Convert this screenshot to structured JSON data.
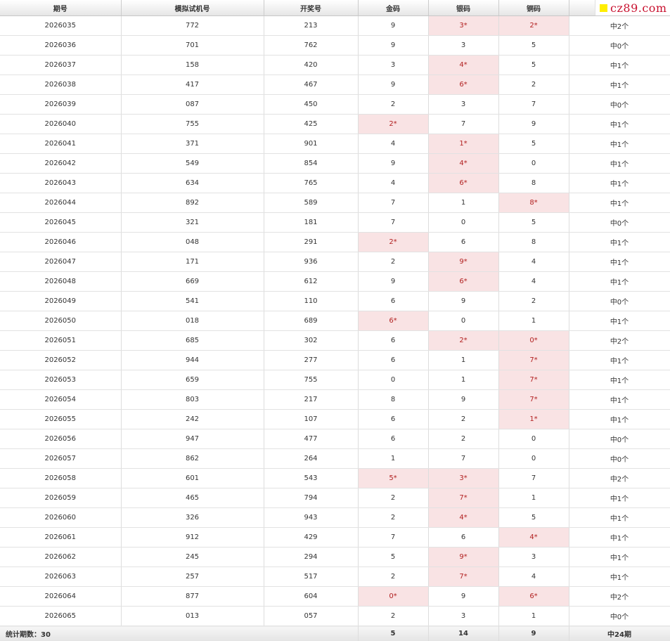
{
  "table": {
    "headers": [
      "期号",
      "模拟试机号",
      "开奖号",
      "金码",
      "银码",
      "铜码",
      ""
    ],
    "rows": [
      {
        "issue": "2026035",
        "sim": "772",
        "draw": "213",
        "gold": "9",
        "gold_hit": false,
        "silver": "3*",
        "silver_hit": true,
        "bronze": "2*",
        "bronze_hit": true,
        "result": "中2个"
      },
      {
        "issue": "2026036",
        "sim": "701",
        "draw": "762",
        "gold": "9",
        "gold_hit": false,
        "silver": "3",
        "silver_hit": false,
        "bronze": "5",
        "bronze_hit": false,
        "result": "中0个"
      },
      {
        "issue": "2026037",
        "sim": "158",
        "draw": "420",
        "gold": "3",
        "gold_hit": false,
        "silver": "4*",
        "silver_hit": true,
        "bronze": "5",
        "bronze_hit": false,
        "result": "中1个"
      },
      {
        "issue": "2026038",
        "sim": "417",
        "draw": "467",
        "gold": "9",
        "gold_hit": false,
        "silver": "6*",
        "silver_hit": true,
        "bronze": "2",
        "bronze_hit": false,
        "result": "中1个"
      },
      {
        "issue": "2026039",
        "sim": "087",
        "draw": "450",
        "gold": "2",
        "gold_hit": false,
        "silver": "3",
        "silver_hit": false,
        "bronze": "7",
        "bronze_hit": false,
        "result": "中0个"
      },
      {
        "issue": "2026040",
        "sim": "755",
        "draw": "425",
        "gold": "2*",
        "gold_hit": true,
        "silver": "7",
        "silver_hit": false,
        "bronze": "9",
        "bronze_hit": false,
        "result": "中1个"
      },
      {
        "issue": "2026041",
        "sim": "371",
        "draw": "901",
        "gold": "4",
        "gold_hit": false,
        "silver": "1*",
        "silver_hit": true,
        "bronze": "5",
        "bronze_hit": false,
        "result": "中1个"
      },
      {
        "issue": "2026042",
        "sim": "549",
        "draw": "854",
        "gold": "9",
        "gold_hit": false,
        "silver": "4*",
        "silver_hit": true,
        "bronze": "0",
        "bronze_hit": false,
        "result": "中1个"
      },
      {
        "issue": "2026043",
        "sim": "634",
        "draw": "765",
        "gold": "4",
        "gold_hit": false,
        "silver": "6*",
        "silver_hit": true,
        "bronze": "8",
        "bronze_hit": false,
        "result": "中1个"
      },
      {
        "issue": "2026044",
        "sim": "892",
        "draw": "589",
        "gold": "7",
        "gold_hit": false,
        "silver": "1",
        "silver_hit": false,
        "bronze": "8*",
        "bronze_hit": true,
        "result": "中1个"
      },
      {
        "issue": "2026045",
        "sim": "321",
        "draw": "181",
        "gold": "7",
        "gold_hit": false,
        "silver": "0",
        "silver_hit": false,
        "bronze": "5",
        "bronze_hit": false,
        "result": "中0个"
      },
      {
        "issue": "2026046",
        "sim": "048",
        "draw": "291",
        "gold": "2*",
        "gold_hit": true,
        "silver": "6",
        "silver_hit": false,
        "bronze": "8",
        "bronze_hit": false,
        "result": "中1个"
      },
      {
        "issue": "2026047",
        "sim": "171",
        "draw": "936",
        "gold": "2",
        "gold_hit": false,
        "silver": "9*",
        "silver_hit": true,
        "bronze": "4",
        "bronze_hit": false,
        "result": "中1个"
      },
      {
        "issue": "2026048",
        "sim": "669",
        "draw": "612",
        "gold": "9",
        "gold_hit": false,
        "silver": "6*",
        "silver_hit": true,
        "bronze": "4",
        "bronze_hit": false,
        "result": "中1个"
      },
      {
        "issue": "2026049",
        "sim": "541",
        "draw": "110",
        "gold": "6",
        "gold_hit": false,
        "silver": "9",
        "silver_hit": false,
        "bronze": "2",
        "bronze_hit": false,
        "result": "中0个"
      },
      {
        "issue": "2026050",
        "sim": "018",
        "draw": "689",
        "gold": "6*",
        "gold_hit": true,
        "silver": "0",
        "silver_hit": false,
        "bronze": "1",
        "bronze_hit": false,
        "result": "中1个"
      },
      {
        "issue": "2026051",
        "sim": "685",
        "draw": "302",
        "gold": "6",
        "gold_hit": false,
        "silver": "2*",
        "silver_hit": true,
        "bronze": "0*",
        "bronze_hit": true,
        "result": "中2个"
      },
      {
        "issue": "2026052",
        "sim": "944",
        "draw": "277",
        "gold": "6",
        "gold_hit": false,
        "silver": "1",
        "silver_hit": false,
        "bronze": "7*",
        "bronze_hit": true,
        "result": "中1个"
      },
      {
        "issue": "2026053",
        "sim": "659",
        "draw": "755",
        "gold": "0",
        "gold_hit": false,
        "silver": "1",
        "silver_hit": false,
        "bronze": "7*",
        "bronze_hit": true,
        "result": "中1个"
      },
      {
        "issue": "2026054",
        "sim": "803",
        "draw": "217",
        "gold": "8",
        "gold_hit": false,
        "silver": "9",
        "silver_hit": false,
        "bronze": "7*",
        "bronze_hit": true,
        "result": "中1个"
      },
      {
        "issue": "2026055",
        "sim": "242",
        "draw": "107",
        "gold": "6",
        "gold_hit": false,
        "silver": "2",
        "silver_hit": false,
        "bronze": "1*",
        "bronze_hit": true,
        "result": "中1个"
      },
      {
        "issue": "2026056",
        "sim": "947",
        "draw": "477",
        "gold": "6",
        "gold_hit": false,
        "silver": "2",
        "silver_hit": false,
        "bronze": "0",
        "bronze_hit": false,
        "result": "中0个"
      },
      {
        "issue": "2026057",
        "sim": "862",
        "draw": "264",
        "gold": "1",
        "gold_hit": false,
        "silver": "7",
        "silver_hit": false,
        "bronze": "0",
        "bronze_hit": false,
        "result": "中0个"
      },
      {
        "issue": "2026058",
        "sim": "601",
        "draw": "543",
        "gold": "5*",
        "gold_hit": true,
        "silver": "3*",
        "silver_hit": true,
        "bronze": "7",
        "bronze_hit": false,
        "result": "中2个"
      },
      {
        "issue": "2026059",
        "sim": "465",
        "draw": "794",
        "gold": "2",
        "gold_hit": false,
        "silver": "7*",
        "silver_hit": true,
        "bronze": "1",
        "bronze_hit": false,
        "result": "中1个"
      },
      {
        "issue": "2026060",
        "sim": "326",
        "draw": "943",
        "gold": "2",
        "gold_hit": false,
        "silver": "4*",
        "silver_hit": true,
        "bronze": "5",
        "bronze_hit": false,
        "result": "中1个"
      },
      {
        "issue": "2026061",
        "sim": "912",
        "draw": "429",
        "gold": "7",
        "gold_hit": false,
        "silver": "6",
        "silver_hit": false,
        "bronze": "4*",
        "bronze_hit": true,
        "result": "中1个"
      },
      {
        "issue": "2026062",
        "sim": "245",
        "draw": "294",
        "gold": "5",
        "gold_hit": false,
        "silver": "9*",
        "silver_hit": true,
        "bronze": "3",
        "bronze_hit": false,
        "result": "中1个"
      },
      {
        "issue": "2026063",
        "sim": "257",
        "draw": "517",
        "gold": "2",
        "gold_hit": false,
        "silver": "7*",
        "silver_hit": true,
        "bronze": "4",
        "bronze_hit": false,
        "result": "中1个"
      },
      {
        "issue": "2026064",
        "sim": "877",
        "draw": "604",
        "gold": "0*",
        "gold_hit": true,
        "silver": "9",
        "silver_hit": false,
        "bronze": "6*",
        "bronze_hit": true,
        "result": "中2个"
      },
      {
        "issue": "2026065",
        "sim": "013",
        "draw": "057",
        "gold": "2",
        "gold_hit": false,
        "silver": "3",
        "silver_hit": false,
        "bronze": "1",
        "bronze_hit": false,
        "result": "中0个"
      }
    ],
    "footer": {
      "label": "统计期数：30",
      "gold_total": "5",
      "silver_total": "14",
      "bronze_total": "9",
      "result_total": "中24期"
    }
  },
  "logo": {
    "text": "cz89.com",
    "square_color": "#ffee00",
    "text_color": "#c8102e"
  },
  "colors": {
    "hit_background": "#f9e3e4",
    "hit_text": "#b22222"
  }
}
